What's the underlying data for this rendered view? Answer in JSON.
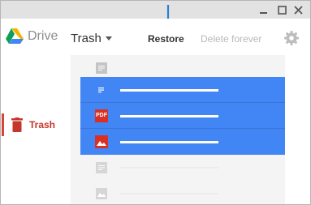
{
  "window": {
    "controls": [
      "minimize-icon",
      "maximize-icon",
      "close-icon"
    ]
  },
  "header": {
    "app_name": "Drive",
    "folder_menu": "Trash",
    "restore_label": "Restore",
    "delete_forever_label": "Delete forever",
    "settings_icon": "gear-icon",
    "pointer_icon": "down-arrow-icon"
  },
  "sidebar": {
    "items": [
      {
        "label": "Trash",
        "icon": "trash-icon",
        "active": true
      }
    ]
  },
  "file_list": {
    "rows": [
      {
        "type": "doc",
        "icon": "doc-icon",
        "selected": false
      },
      {
        "type": "doc",
        "icon": "doc-icon",
        "selected": true
      },
      {
        "type": "pdf",
        "icon": "pdf-icon",
        "icon_text": "PDF",
        "selected": true
      },
      {
        "type": "image",
        "icon": "image-icon",
        "selected": true
      },
      {
        "type": "doc",
        "icon": "doc-icon",
        "selected": false
      },
      {
        "type": "image",
        "icon": "image-icon",
        "selected": false
      }
    ]
  },
  "colors": {
    "selection": "#4285f4",
    "trash_accent": "#c5372c",
    "arrow": "#2a7fd4",
    "pdf": "#d93025"
  }
}
